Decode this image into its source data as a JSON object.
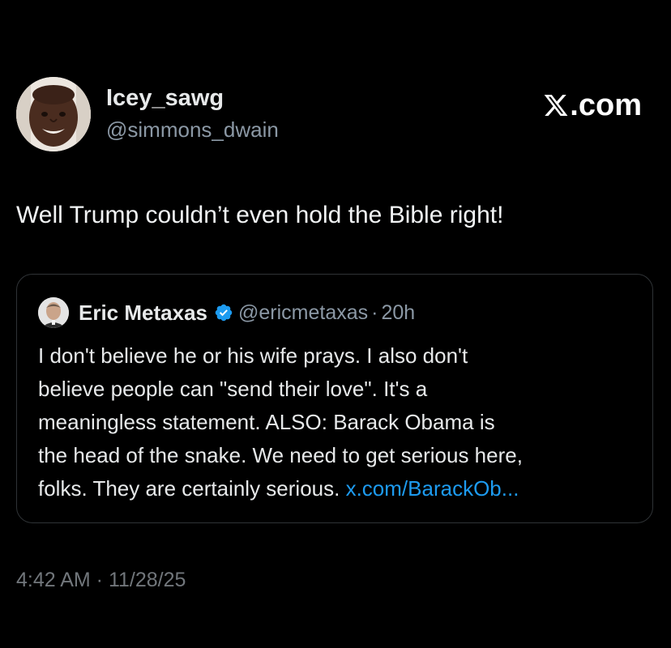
{
  "post": {
    "author": {
      "display_name": "Icey_sawg",
      "handle": "@simmons_dwain"
    },
    "brand": ".com",
    "text": "Well Trump couldn’t even hold the Bible right!",
    "timestamp": "4:42 AM · 11/28/25"
  },
  "quoted_post": {
    "author": {
      "display_name": "Eric Metaxas",
      "handle": "@ericmetaxas",
      "verified": true
    },
    "separator": "·",
    "time_ago": "20h",
    "lines": [
      "I don't believe he or his wife prays. I also don't",
      "believe people can \"send their love\". It's a",
      "meaningless statement. ALSO: Barack Obama is",
      "the head of the snake. We need to get serious here,"
    ],
    "last_line_text": "folks. They are certainly serious. ",
    "link_text": "x.com/BarackOb..."
  },
  "colors": {
    "background": "#000000",
    "primary_text": "#e7e9ea",
    "secondary_text": "#8b98a5",
    "link": "#1d9bf0",
    "verified_badge": "#1d9bf0",
    "card_border": "#2f3336"
  },
  "icons": {
    "brand_logo": "x-logo-icon",
    "verified": "verified-badge-icon"
  }
}
